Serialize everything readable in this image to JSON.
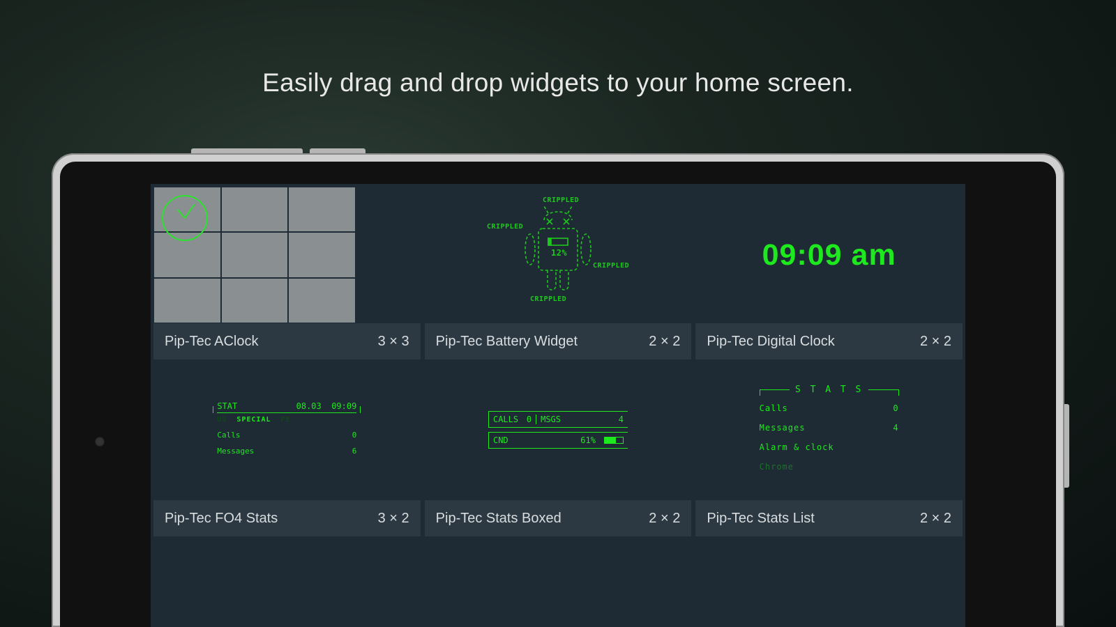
{
  "headline": "Easily drag and drop widgets to your home screen.",
  "accent_color": "#1ee81e",
  "widgets": [
    {
      "name": "Pip-Tec AClock",
      "size": "3 × 3"
    },
    {
      "name": "Pip-Tec Battery Widget",
      "size": "2 × 2",
      "battery_pct": "12%",
      "crippled_labels": [
        "CRIPPLED",
        "CRIPPLED",
        "CRIPPLED",
        "CRIPPLED"
      ]
    },
    {
      "name": "Pip-Tec Digital Clock",
      "size": "2 × 2",
      "time": "09:09 am"
    },
    {
      "name": "Pip-Tec FO4 Stats",
      "size": "3 × 2",
      "stat_label": "STAT",
      "date": "08.03",
      "time2": "09:09",
      "tabs": [
        "US",
        "SPECIAL",
        "PE"
      ],
      "active_tab": "SPECIAL",
      "rows": [
        {
          "label": "Calls",
          "value": "0"
        },
        {
          "label": "Messages",
          "value": "6"
        }
      ]
    },
    {
      "name": "Pip-Tec Stats Boxed",
      "size": "2 × 2",
      "line1": {
        "calls_label": "CALLS",
        "calls": "0",
        "msgs_label": "MSGS",
        "msgs": "4"
      },
      "line2": {
        "cnd_label": "CND",
        "cnd": "61%"
      }
    },
    {
      "name": "Pip-Tec Stats List",
      "size": "2 × 2",
      "head": "S T A T S",
      "rows": [
        {
          "label": "Calls",
          "value": "0"
        },
        {
          "label": "Messages",
          "value": "4"
        },
        {
          "label": "Alarm & clock",
          "value": ""
        },
        {
          "label": "Chrome",
          "value": ""
        }
      ]
    }
  ]
}
